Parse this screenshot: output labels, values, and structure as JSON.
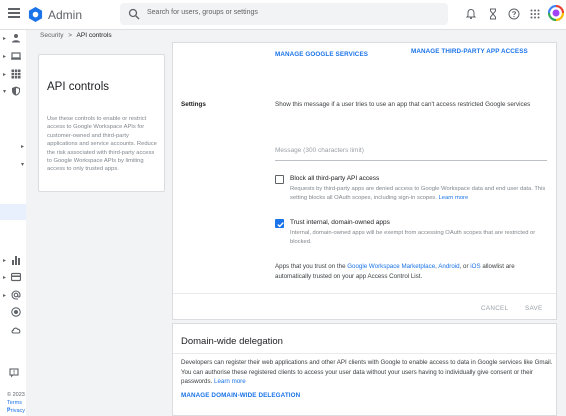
{
  "header": {
    "app_title": "Admin",
    "search_placeholder": "Search for users, groups or settings"
  },
  "breadcrumb": {
    "parent": "Security",
    "separator": ">",
    "current": "API controls"
  },
  "side_panel": {
    "title": "API controls",
    "description": "Use these controls to enable or restrict access to Google Workspace APIs for customer-owned and third-party applications and service accounts. Reduce the risk associated with third-party access to Google Workspace APIs by limiting access to only trusted apps."
  },
  "settings_card": {
    "manage_google_services": "MANAGE GOOGLE SERVICES",
    "manage_third_party": "MANAGE THIRD-PARTY APP ACCESS",
    "settings_label": "Settings",
    "message_description": "Show this message if a user tries to use an app that can't access restricted Google services",
    "message_placeholder": "Message (300 characters limit)",
    "options": [
      {
        "title": "Block all third-party API access",
        "checked": false,
        "description": "Requests by third-party apps are denied access to Google Workspace data and end user data. This setting blocks all OAuth scopes, including sign-in scopes.",
        "link": "Learn more"
      },
      {
        "title": "Trust internal, domain-owned apps",
        "checked": true,
        "description": "Internal, domain-owned apps will be exempt from accessing OAuth scopes that are restricted or blocked."
      }
    ],
    "trust_prefix": "Apps that you trust on the ",
    "trust_link1": "Google Workspace Marketplace",
    "trust_sep1": ", ",
    "trust_link2": "Android",
    "trust_sep2": ", or ",
    "trust_link3": "iOS",
    "trust_suffix": " allowlist are automatically trusted on your app Access Control List.",
    "cancel_label": "CANCEL",
    "save_label": "SAVE"
  },
  "delegation_card": {
    "title": "Domain-wide delegation",
    "description": "Developers can register their web applications and other API clients with Google to enable access to data in Google services like Gmail. You can authorise these registered clients to access your user data without your users having to individually give consent or their passwords.",
    "link": "Learn more",
    "manage_label": "MANAGE DOMAIN-WIDE DELEGATION"
  },
  "rail_footer": {
    "copyright": "© 2023",
    "terms": "Terms o",
    "privacy": "Privacy"
  },
  "colors": {
    "accent": "#1a73e8",
    "logo": "#1a73e8",
    "background": "#f1f3f4"
  }
}
